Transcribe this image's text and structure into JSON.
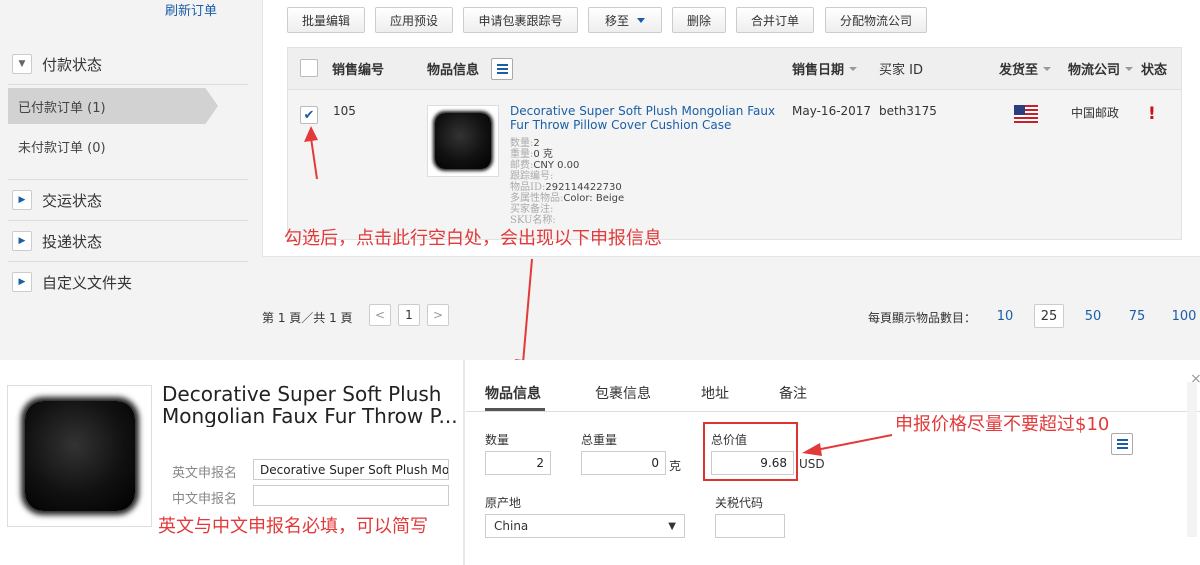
{
  "sidebar": {
    "refresh": "刷新订单",
    "payment_status": "付款状态",
    "paid_orders": "已付款订单 (1)",
    "unpaid_orders": "未付款订单 (0)",
    "shipping_status": "交运状态",
    "delivery_status": "投递状态",
    "custom_folder": "自定义文件夹"
  },
  "toolbar": {
    "batch_edit": "批量编辑",
    "apply_preset": "应用预设",
    "request_tracking": "申请包裹跟踪号",
    "move_to": "移至",
    "delete": "删除",
    "merge_orders": "合并订单",
    "assign_logistics": "分配物流公司"
  },
  "table": {
    "headers": {
      "sale_no": "销售编号",
      "item_info": "物品信息",
      "sale_date": "销售日期",
      "buyer_id": "买家 ID",
      "ship_to": "发货至",
      "logistics": "物流公司",
      "status": "状态"
    },
    "row": {
      "sale_no": "105",
      "title": "Decorative Super Soft Plush Mongolian Faux Fur Throw Pillow Cover Cushion Case",
      "qty_label": "数量:",
      "qty": "2",
      "weight_label": "重量:",
      "weight": "0 克",
      "postage_label": "邮费:",
      "postage": "CNY 0.00",
      "tracking_label": "跟踪编号:",
      "tracking": "",
      "item_id_label": "物品ID:",
      "item_id": "292114422730",
      "variation_label": "多属性物品:",
      "variation": "Color: Beige",
      "buyer_note_label": "买家备注:",
      "buyer_note": "",
      "sku_label": "SKU名称:",
      "sku": "",
      "sale_date": "May-16-2017",
      "buyer_id": "beth3175",
      "logistics": "中国邮政",
      "status_mark": "!"
    }
  },
  "pagination": {
    "page_info": "第 1 頁／共 1 頁",
    "prev": "<",
    "current": "1",
    "next": ">",
    "per_page_label": "每頁顯示物品數目：",
    "options": [
      "10",
      "25",
      "50",
      "75",
      "100"
    ]
  },
  "annotations": {
    "select_hint": "勾选后，点击此行空白处，会出现以下申报信息",
    "price_hint": "申报价格尽量不要超过$10",
    "name_hint": "英文与中文申报名必填，可以简写"
  },
  "detail": {
    "title_line1": "Decorative Super Soft Plush",
    "title_line2": "Mongolian Faux Fur Throw P...",
    "en_name_label": "英文申报名",
    "en_name_value": "Decorative Super Soft Plush Mongolian",
    "cn_name_label": "中文申报名",
    "cn_name_value": "",
    "tabs": [
      "物品信息",
      "包裹信息",
      "地址",
      "备注"
    ],
    "qty_label": "数量",
    "qty_value": "2",
    "weight_label": "总重量",
    "weight_value": "0",
    "weight_unit": "克",
    "total_label": "总价值",
    "total_value": "9.68",
    "currency": "USD",
    "origin_label": "原产地",
    "origin_value": "China",
    "tariff_label": "关税代码",
    "tariff_value": "",
    "close": "×"
  },
  "colors": {
    "accent": "#1a5ea8",
    "annotation": "#e23a3a"
  }
}
